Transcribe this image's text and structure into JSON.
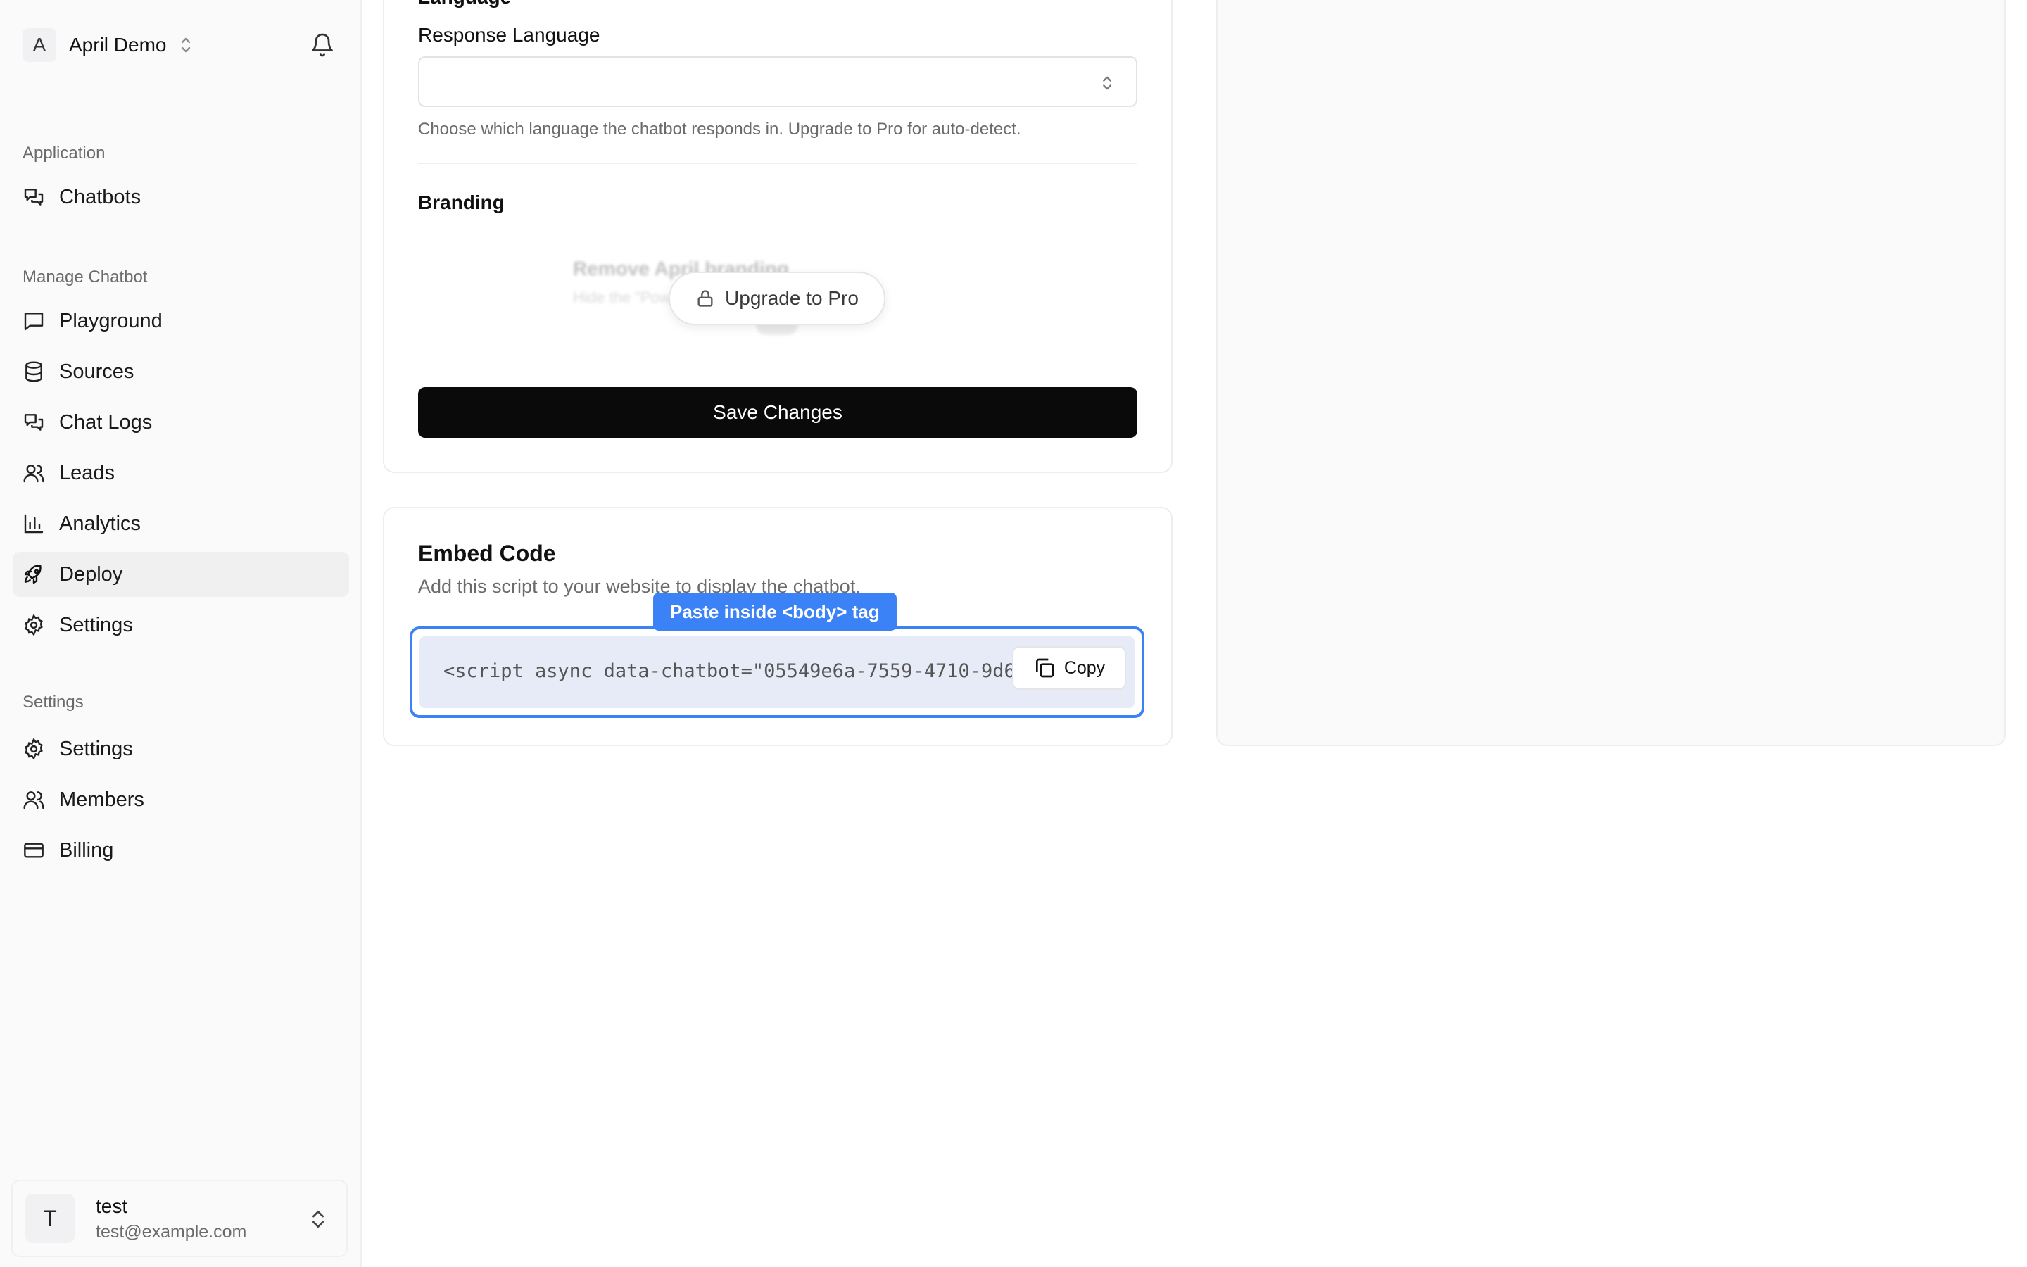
{
  "org": {
    "avatar_letter": "A",
    "name": "April Demo"
  },
  "sidebar": {
    "groups": [
      {
        "label": "Application",
        "items": [
          {
            "label": "Chatbots",
            "icon": "chat-bubbles-icon"
          }
        ]
      },
      {
        "label": "Manage Chatbot",
        "items": [
          {
            "label": "Playground",
            "icon": "message-square-icon"
          },
          {
            "label": "Sources",
            "icon": "database-icon"
          },
          {
            "label": "Chat Logs",
            "icon": "chat-bubbles-icon"
          },
          {
            "label": "Leads",
            "icon": "users-icon"
          },
          {
            "label": "Analytics",
            "icon": "bar-chart-icon"
          },
          {
            "label": "Deploy",
            "icon": "rocket-icon",
            "active": true
          },
          {
            "label": "Settings",
            "icon": "gear-icon"
          }
        ]
      },
      {
        "label": "Settings",
        "items": [
          {
            "label": "Settings",
            "icon": "gear-icon"
          },
          {
            "label": "Members",
            "icon": "users-icon"
          },
          {
            "label": "Billing",
            "icon": "credit-card-icon"
          }
        ]
      }
    ]
  },
  "user": {
    "avatar_letter": "T",
    "name": "test",
    "email": "test@example.com"
  },
  "settings_card": {
    "section_label": "Language",
    "response_language": {
      "label": "Response Language",
      "value": "",
      "help": "Choose which language the chatbot responds in. Upgrade to Pro for auto-detect."
    },
    "branding": {
      "title": "Branding",
      "locked_title": "Remove April branding",
      "locked_desc": "Hide the \"Powered by April\" text in the widget",
      "upgrade_label": "Upgrade to Pro"
    },
    "save_label": "Save Changes"
  },
  "embed": {
    "title": "Embed Code",
    "subtitle": "Add this script to your website to display the chatbot.",
    "tag_hint": "Paste inside <body> tag",
    "code": "<script async data-chatbot=\"05549e6a-7559-4710-9d6",
    "copy_label": "Copy"
  },
  "colors": {
    "accent": "#3b82f6",
    "primary_button": "#0a0a0a"
  }
}
